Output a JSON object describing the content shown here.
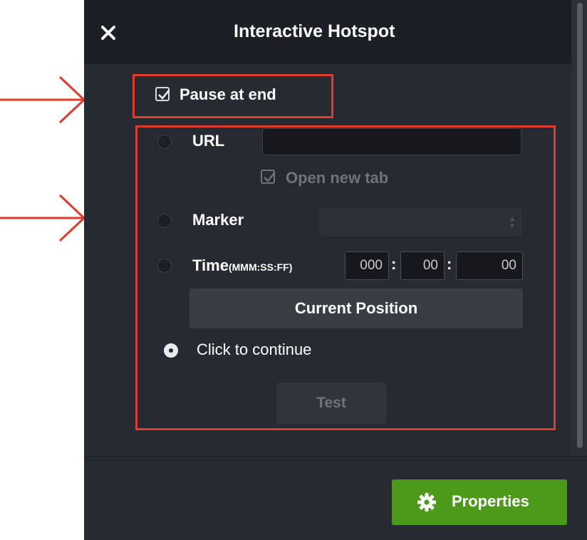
{
  "panel": {
    "title": "Interactive Hotspot",
    "close_icon": "close-icon",
    "pause_at_end": {
      "label": "Pause at end",
      "checked": true
    },
    "options": {
      "url": {
        "label": "URL",
        "value": "",
        "selected": false
      },
      "open_new_tab": {
        "label": "Open new tab",
        "checked": true,
        "disabled": true
      },
      "marker": {
        "label": "Marker",
        "value": "",
        "selected": false
      },
      "time": {
        "label": "Time",
        "format": "(MMM:SS:FF)",
        "minutes": "000",
        "seconds": "00",
        "frames": "00",
        "selected": false
      },
      "current_position_label": "Current Position",
      "click_to_continue": {
        "label": "Click to continue",
        "selected": true
      },
      "test_label": "Test"
    },
    "properties_label": "Properties",
    "properties_icon": "gear-icon"
  },
  "annotations": {
    "highlight_color": "#e43a2a",
    "arrow_count": 2
  },
  "colors": {
    "panel_bg": "#262a33",
    "title_bg": "#1c1f25",
    "accent_green": "#4d9a1b"
  }
}
